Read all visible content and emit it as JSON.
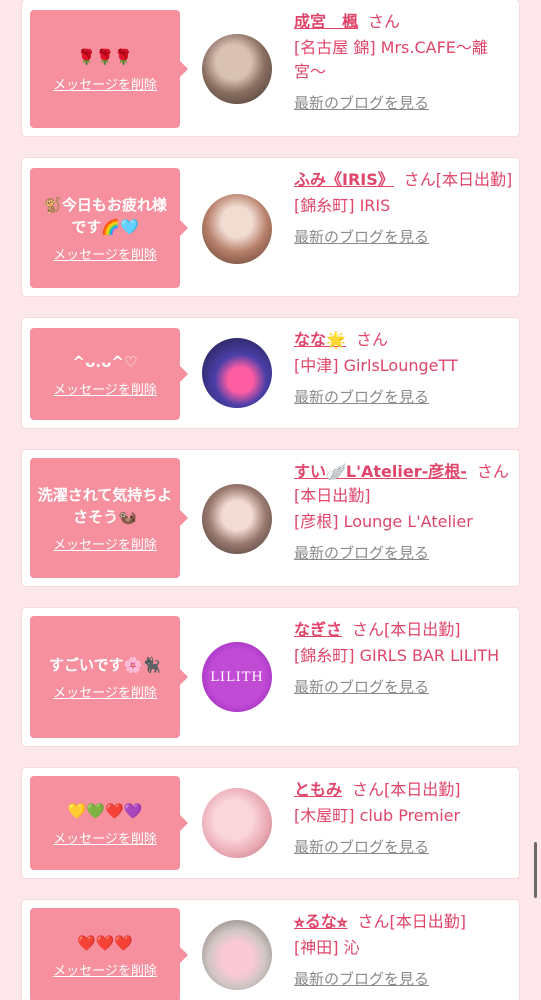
{
  "delete_label": "メッセージを削除",
  "blog_label": "最新のブログを見る",
  "colors": {
    "bubble": "#f7909e",
    "accent": "#e0456a",
    "background": "#fde7ea"
  },
  "cards": [
    {
      "message": "🌹🌹🌹",
      "name": "成宮　楓",
      "suffix": "さん",
      "shop": "[名古屋 錦] Mrs.CAFE〜離宮〜"
    },
    {
      "message": "🐒今日もお疲れ様です🌈🩵",
      "name": "ふみ《IRIS》",
      "suffix": "さん[本日出勤]",
      "shop": "[錦糸町] IRIS"
    },
    {
      "message": "^ᴗ.ᴗ^♡",
      "name": "なな🌟",
      "suffix": "さん",
      "shop": "[中津] GirlsLoungeTT"
    },
    {
      "message": "洗濯されて気持ちよさそう🦦",
      "name": "すい🪽L'Atelier-彦根-",
      "suffix": "さん[本日出勤]",
      "shop": "[彦根] Lounge L'Atelier"
    },
    {
      "message": "すごいです🌸🐈‍⬛",
      "name": "なぎさ",
      "suffix": "さん[本日出勤]",
      "shop": "[錦糸町] GIRLS BAR LILITH",
      "avatar_text": "LILITH"
    },
    {
      "message": "💛💚❤️💜",
      "name": "ともみ",
      "suffix": "さん[本日出勤]",
      "shop": "[木屋町] club Premier"
    },
    {
      "message": "❤️❤️❤️",
      "name": "⭐︎るな⭐︎",
      "suffix": "さん[本日出勤]",
      "shop": "[神田] 沁"
    }
  ]
}
